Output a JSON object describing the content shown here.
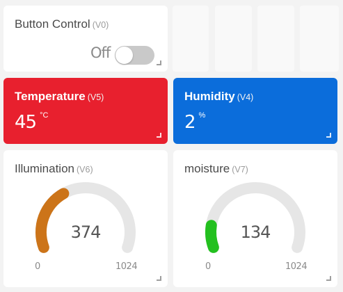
{
  "button_tile": {
    "title": "Button Control",
    "pin": "(V0)",
    "state_label": "Off",
    "is_on": false,
    "track_color": "#c9c9c9"
  },
  "temperature_tile": {
    "title": "Temperature",
    "pin": "(V5)",
    "value": "45",
    "unit": "°C",
    "color": "#e8202e"
  },
  "humidity_tile": {
    "title": "Humidity",
    "pin": "(V4)",
    "value": "2",
    "unit": "%",
    "color": "#0b6ddb"
  },
  "illumination_gauge": {
    "title": "Illumination",
    "pin": "(V6)",
    "value": 374,
    "min": 0,
    "max": 1024,
    "color": "#cc7419",
    "track_color": "#e6e6e6"
  },
  "moisture_gauge": {
    "title": "moisture",
    "pin": "(V7)",
    "value": 134,
    "min": 0,
    "max": 1024,
    "color": "#23c01f",
    "track_color": "#e6e6e6"
  }
}
